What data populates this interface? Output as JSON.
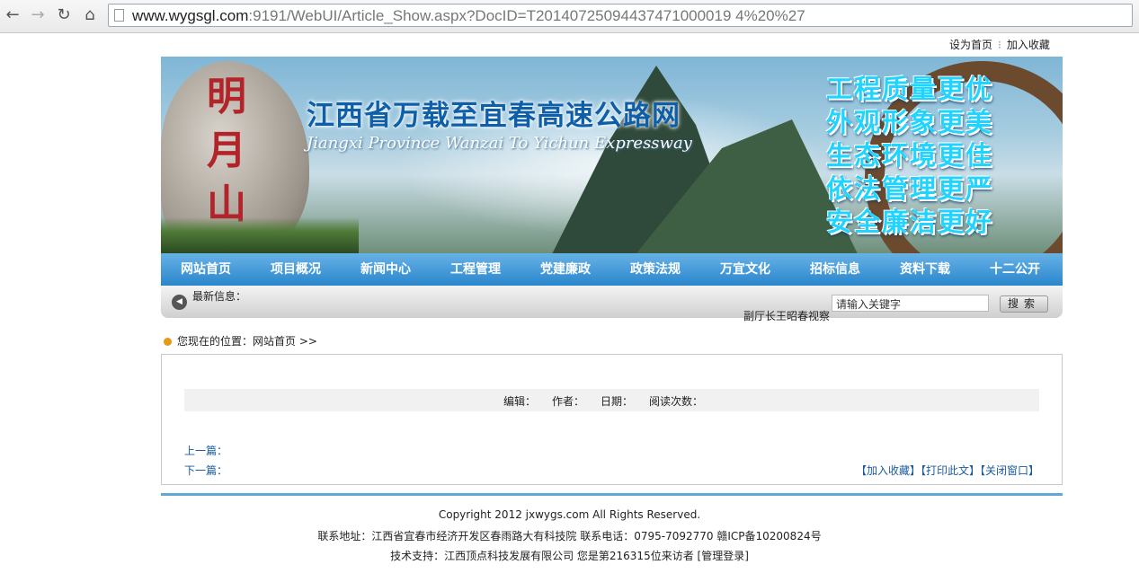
{
  "browser": {
    "url_host": "www.wygsgl.com",
    "url_path": ":9191/WebUI/Article_Show.aspx?DocID=T20140725094437471000019 4%20%27"
  },
  "toplinks": {
    "homepage": "设为首页",
    "favorite": "加入收藏"
  },
  "banner": {
    "title": "江西省万载至宜春高速公路网",
    "subtitle": "Jiangxi Province Wanzai To Yichun Expressway",
    "rock_text": "明月山",
    "slogans": [
      "工程质量更优",
      "外观形象更美",
      "生态环境更佳",
      "依法管理更严",
      "安全廉洁更好"
    ]
  },
  "nav": [
    "网站首页",
    "项目概况",
    "新闻中心",
    "工程管理",
    "党建廉政",
    "政策法规",
    "万宜文化",
    "招标信息",
    "资料下载",
    "十二公开"
  ],
  "infobar": {
    "label": "最新信息：",
    "ticker": "副厅长王昭春视察",
    "search_placeholder": "请输入关键字",
    "search_button": "搜索"
  },
  "breadcrumb": {
    "text": "您现在的位置：网站首页 >>"
  },
  "article": {
    "meta": {
      "editor": "编辑：",
      "author": "作者：",
      "date": "日期：",
      "reads": "阅读次数："
    },
    "prev": "上一篇：",
    "next": "下一篇：",
    "add_favorite": "【加入收藏】",
    "print": "【打印此文】",
    "close": "【关闭窗口】"
  },
  "footer": {
    "copyright": "Copyright 2012 jxwygs.com All Rights Reserved.",
    "address": "联系地址：江西省宜春市经济开发区春雨路大有科技院   联系电话：0795-7092770   赣ICP备10200824号",
    "support": "技术支持：江西顶点科技发展有限公司   您是第216315位来访者",
    "admin": "[管理登录]"
  }
}
